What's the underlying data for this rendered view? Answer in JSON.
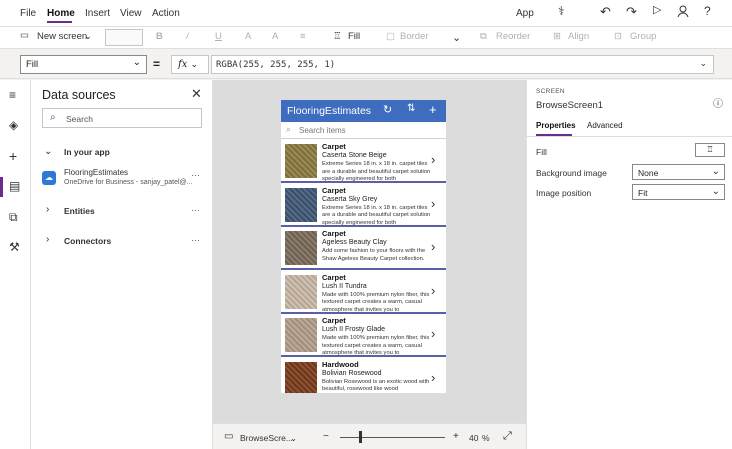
{
  "menubar": {
    "items": [
      "File",
      "Home",
      "Insert",
      "View",
      "Action"
    ],
    "app_label": "App"
  },
  "toolbar": {
    "new_screen": "New screen",
    "fill": "Fill",
    "border": "Border",
    "reorder": "Reorder",
    "align": "Align",
    "group": "Group"
  },
  "formula_bar": {
    "property": "Fill",
    "equals": "=",
    "fx": "fx",
    "formula": "RGBA(255, 255, 255, 1)"
  },
  "data_panel": {
    "title": "Data sources",
    "search_placeholder": "Search",
    "in_your_app": "In your app",
    "source_name": "FlooringEstimates",
    "source_sub": "OneDrive for Business - sanjay_patel@...",
    "entities": "Entities",
    "connectors": "Connectors"
  },
  "app": {
    "title": "FlooringEstimates",
    "search_placeholder": "Search items",
    "items": [
      {
        "category": "Carpet",
        "name": "Caserta Stone Beige",
        "desc": "Extreme Series 18 in. x 18 in. carpet tiles are a durable and beautiful carpet solution specially engineered for both",
        "swatch": "#8c7a3e"
      },
      {
        "category": "Carpet",
        "name": "Caserta Sky Grey",
        "desc": "Extreme Series 18 in. x 18 in. carpet tiles are a durable and beautiful carpet solution specially engineered for both",
        "swatch": "#3f5775"
      },
      {
        "category": "Carpet",
        "name": "Ageless Beauty Clay",
        "desc": "Add some fashion to your floors with the Shaw Ageless Beauty Carpet collection.",
        "swatch": "#7a6a5a"
      },
      {
        "category": "Carpet",
        "name": "Lush II Tundra",
        "desc": "Made with 100% premium nylon fiber, this textured carpet creates a warm, casual atmosphere that invites you to",
        "swatch": "#c9b8a6"
      },
      {
        "category": "Carpet",
        "name": "Lush II Frosty Glade",
        "desc": "Made with 100% premium nylon fiber, this textured carpet creates a warm, casual atmosphere that invites you to",
        "swatch": "#b39e8a"
      },
      {
        "category": "Hardwood",
        "name": "Bolivian Rosewood",
        "desc": "Bolivian Rosewood is an exotic wood with beautiful, rosewood like wood",
        "swatch": "#7a3b1a"
      }
    ]
  },
  "bottombar": {
    "screen_name": "BrowseScre...",
    "minus": "−",
    "plus": "+",
    "zoom": "40",
    "pct": "%"
  },
  "props": {
    "kind": "SCREEN",
    "screen_name": "BrowseScreen1",
    "tab_properties": "Properties",
    "tab_advanced": "Advanced",
    "fill_label": "Fill",
    "bg_image_label": "Background image",
    "bg_image_value": "None",
    "img_pos_label": "Image position",
    "img_pos_value": "Fit"
  },
  "colors": {
    "accent": "#6b2c8f",
    "app_header": "#3e6dbf",
    "item_border": "#5b5fa6"
  }
}
